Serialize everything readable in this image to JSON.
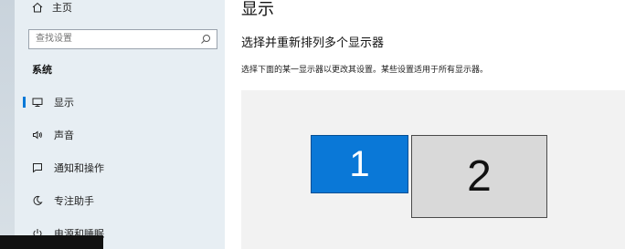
{
  "sidebar": {
    "home_label": "主页",
    "search_placeholder": "查找设置",
    "section_title": "系统",
    "items": [
      {
        "label": "显示",
        "icon": "monitor-icon"
      },
      {
        "label": "声音",
        "icon": "speaker-icon"
      },
      {
        "label": "通知和操作",
        "icon": "notification-icon"
      },
      {
        "label": "专注助手",
        "icon": "moon-icon"
      },
      {
        "label": "电源和睡眠",
        "icon": "power-icon"
      }
    ]
  },
  "main": {
    "title": "显示",
    "subheading": "选择并重新排列多个显示器",
    "description": "选择下面的某一显示器以更改其设置。某些设置适用于所有显示器。",
    "monitors": [
      {
        "number": "1",
        "selected": true,
        "color": "#0a78d7"
      },
      {
        "number": "2",
        "selected": false,
        "color": "#d9d9d9"
      }
    ]
  },
  "colors": {
    "accent": "#0078d7",
    "sidebar_bg": "#e7eef3"
  }
}
